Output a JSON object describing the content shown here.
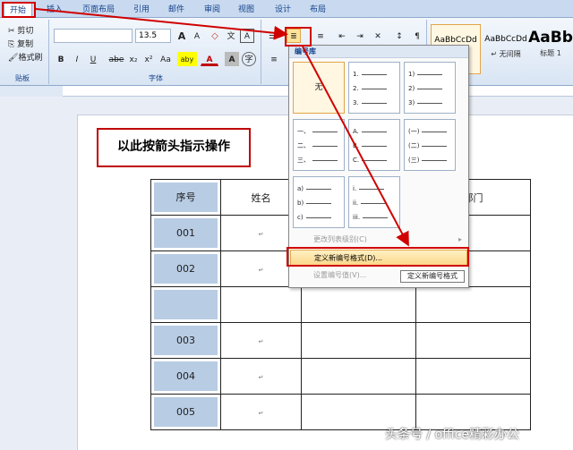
{
  "tabs": [
    "开始",
    "插入",
    "页面布局",
    "引用",
    "邮件",
    "审阅",
    "视图",
    "设计",
    "布局"
  ],
  "clipboard": {
    "cut": "剪切",
    "copy": "复制",
    "format_painter": "格式刷",
    "group_label": "贴板"
  },
  "font": {
    "size": "13.5",
    "group_label": "字体",
    "bold": "B",
    "italic": "I",
    "underline": "U",
    "strike": "abe",
    "sub": "x₂",
    "sup": "x²",
    "case": "Aa",
    "grow": "A",
    "shrink": "A",
    "highlight": "aby",
    "color": "A",
    "charshade": "A"
  },
  "styles": [
    {
      "preview": "AaBbCcDd",
      "name": ""
    },
    {
      "preview": "AaBbCcDd",
      "name": "↵ 无间隔"
    },
    {
      "preview": "AaBb",
      "name": "标题 1"
    }
  ],
  "callout": "以此按箭头指示操作",
  "table": {
    "header": [
      "序号",
      "姓名",
      "",
      "部门"
    ],
    "rows": [
      "001",
      "002",
      "",
      "003",
      "004",
      "005"
    ]
  },
  "dropdown": {
    "header": "编号库",
    "none": "无",
    "lists": [
      [
        "1.",
        "2.",
        "3."
      ],
      [
        "1)",
        "2)",
        "3)"
      ],
      [
        "一、",
        "二、",
        "三、"
      ],
      [
        "A.",
        "B.",
        "C."
      ],
      [
        "(一)",
        "(二)",
        "(三)"
      ],
      [
        "a)",
        "b)",
        "c)"
      ],
      [
        "i.",
        "ii.",
        "iii."
      ]
    ],
    "menu": {
      "change_level": "更改列表级别(C)",
      "define_new": "定义新编号格式(D)...",
      "set_value": "设置编号值(V)..."
    }
  },
  "tooltip": "定义新编号格式",
  "watermark": "头条号 / office精彩办公",
  "para_mark": "↵"
}
